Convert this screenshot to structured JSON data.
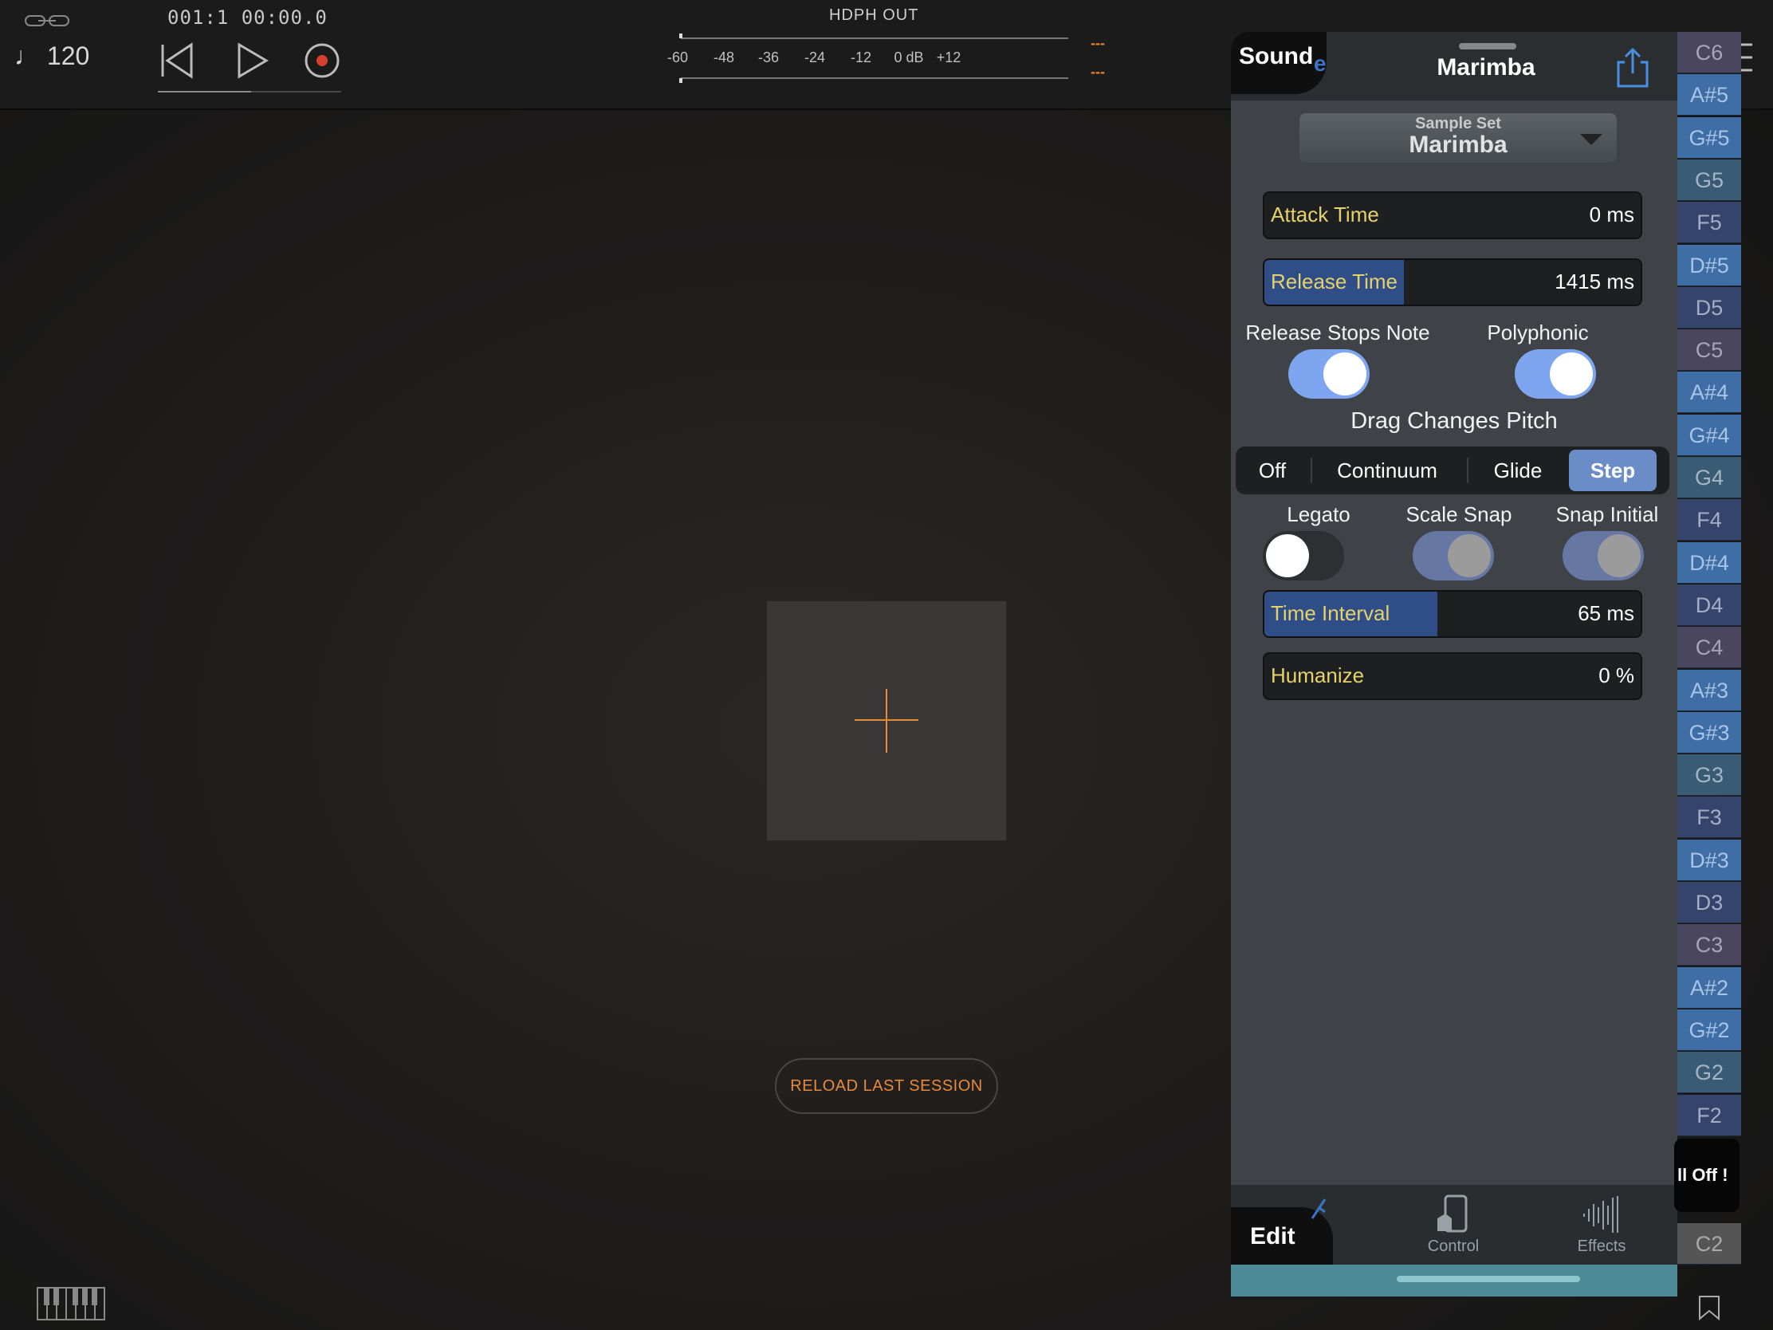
{
  "header": {
    "tempo": "♩ 120",
    "position": "001:1  00:00.0",
    "meter_label": "HDPH OUT",
    "meter_ticks": [
      "-60",
      "-48",
      "-36",
      "-24",
      "-12",
      "0 dB",
      "+12"
    ],
    "peak_left": "---",
    "peak_right": "---"
  },
  "main": {
    "reload_label": "RELOAD LAST SESSION"
  },
  "panel": {
    "sound_tab": "Sound",
    "title": "Marimba",
    "sample_set_label": "Sample Set",
    "sample_set_value": "Marimba",
    "attack": {
      "label": "Attack Time",
      "value": "0 ms",
      "fill_pct": 0
    },
    "release": {
      "label": "Release Time",
      "value": "1415 ms",
      "fill_pct": 37
    },
    "release_stops_note": {
      "label": "Release Stops Note",
      "on": true
    },
    "polyphonic": {
      "label": "Polyphonic",
      "on": true
    },
    "drag_pitch_label": "Drag Changes Pitch",
    "drag_options": [
      "Off",
      "Continuum",
      "Glide",
      "Step"
    ],
    "drag_selected": "Step",
    "legato": {
      "label": "Legato",
      "on": false
    },
    "scale_snap": {
      "label": "Scale Snap",
      "on": true
    },
    "snap_initial": {
      "label": "Snap Initial",
      "on": true
    },
    "time_interval": {
      "label": "Time Interval",
      "value": "65 ms",
      "fill_pct": 46
    },
    "humanize": {
      "label": "Humanize",
      "value": "0 %",
      "fill_pct": 0
    },
    "tabs": {
      "edit": "Edit",
      "control": "Control",
      "effects": "Effects"
    }
  },
  "notes": [
    "C6",
    "A#5",
    "G#5",
    "G5",
    "F5",
    "D#5",
    "D5",
    "C5",
    "A#4",
    "G#4",
    "G4",
    "F4",
    "D#4",
    "D4",
    "C4",
    "A#3",
    "G#3",
    "G3",
    "F3",
    "D#3",
    "D3",
    "C3",
    "A#2",
    "G#2",
    "G2",
    "F2"
  ],
  "notes_bottom": "C2",
  "all_off": "ll Off !",
  "colors": {
    "accent": "#e98a3a",
    "toggle_on": "#7ea6f0",
    "slider_fill": "#2f4e88"
  }
}
